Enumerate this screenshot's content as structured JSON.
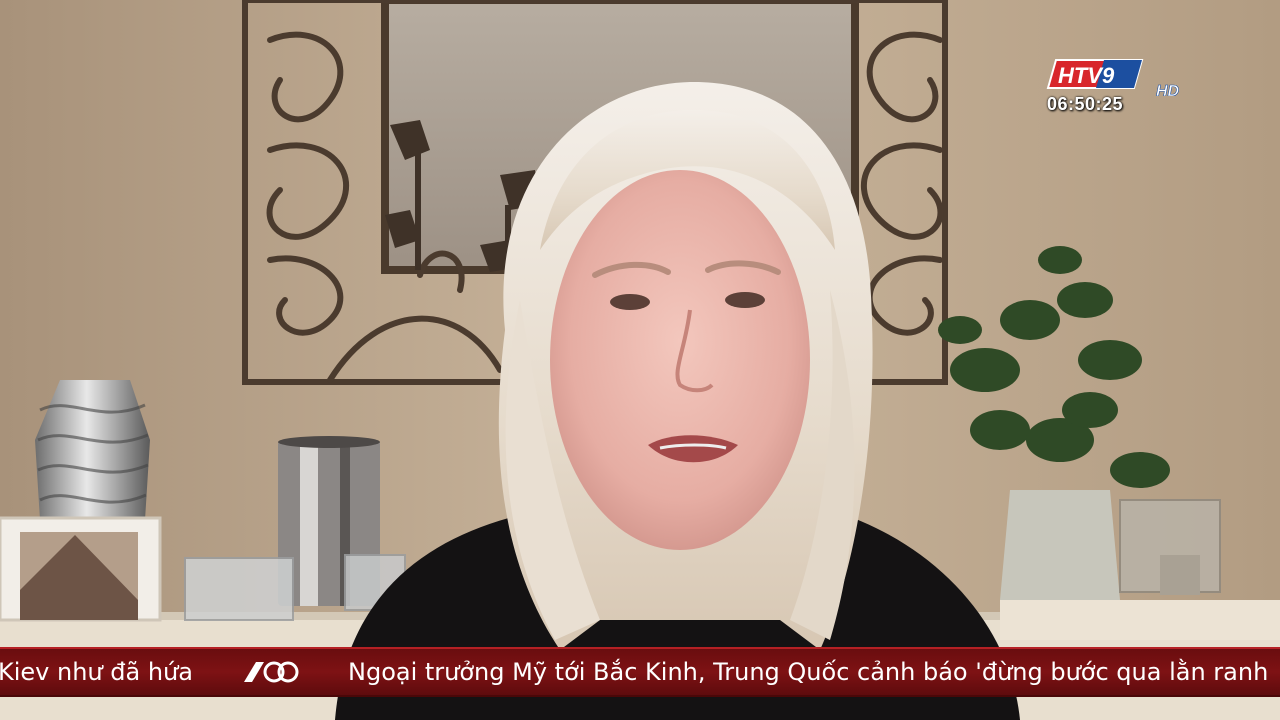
{
  "broadcast": {
    "channel_logo": "HTV9",
    "channel_logo_suffix": "HD",
    "clock": "06:50:25"
  },
  "ticker": {
    "previous_fragment": "Kiev như đã hứa",
    "separator_icon": "htv-60-logo-icon",
    "headline": "Ngoại trưởng Mỹ tới Bắc Kinh, Trung Quốc cảnh báo 'đừng bước qua lằn ranh"
  },
  "colors": {
    "ticker_red": "#7e1214",
    "ticker_text": "#ffffff",
    "logo_red": "#d8262b",
    "logo_blue": "#1c4fa0"
  }
}
